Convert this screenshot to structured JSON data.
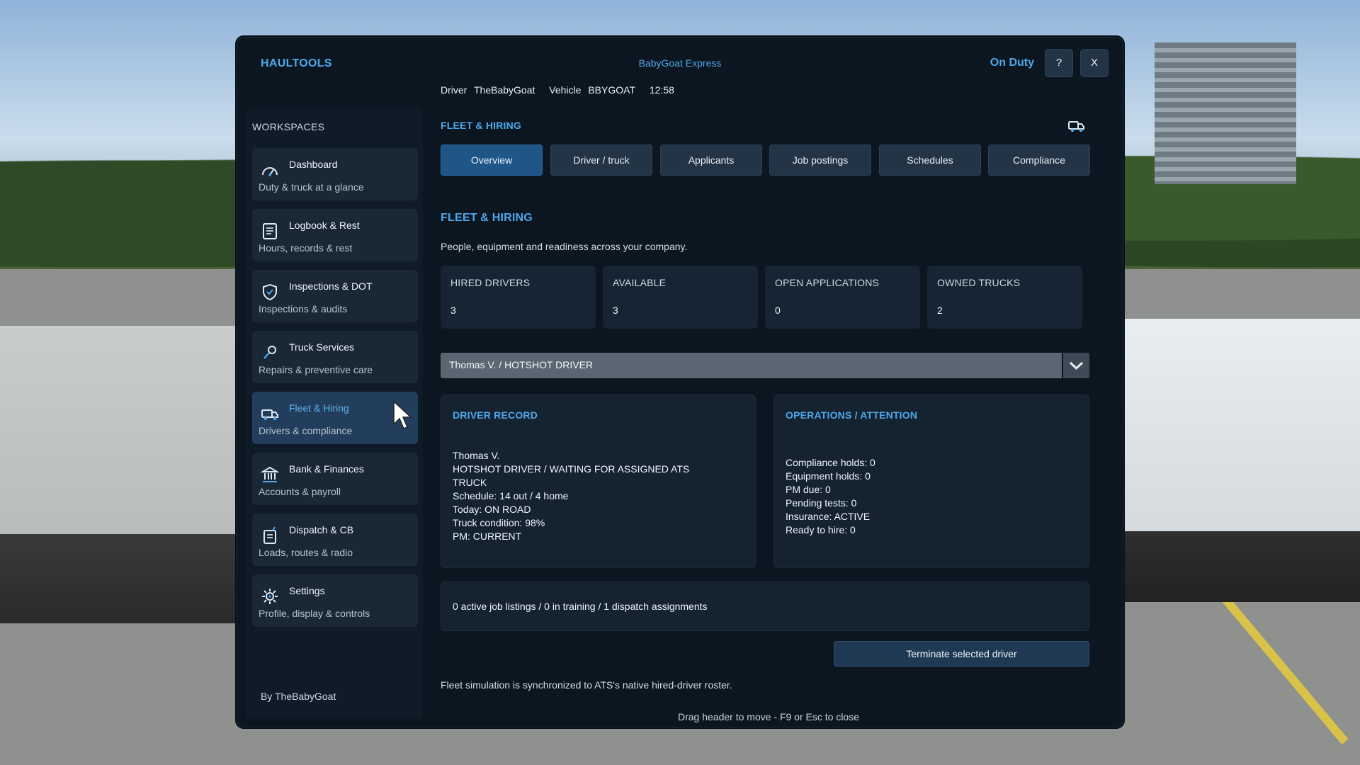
{
  "header": {
    "app_title": "HAULTOOLS",
    "company": "BabyGoat Express",
    "duty_status": "On Duty",
    "help_label": "?",
    "close_label": "X",
    "driver_label": "Driver",
    "driver_name": "TheBabyGoat",
    "vehicle_label": "Vehicle",
    "vehicle_id": "BBYGOAT",
    "time": "12:58"
  },
  "sidebar": {
    "title": "WORKSPACES",
    "items": [
      {
        "label": "Dashboard",
        "sub": "Duty & truck at a glance",
        "icon": "gauge-icon"
      },
      {
        "label": "Logbook & Rest",
        "sub": "Hours, records & rest",
        "icon": "logbook-icon"
      },
      {
        "label": "Inspections & DOT",
        "sub": "Inspections & audits",
        "icon": "shield-check-icon"
      },
      {
        "label": "Truck Services",
        "sub": "Repairs & preventive care",
        "icon": "wrench-icon"
      },
      {
        "label": "Fleet & Hiring",
        "sub": "Drivers & compliance",
        "icon": "truck-icon",
        "active": true
      },
      {
        "label": "Bank & Finances",
        "sub": "Accounts & payroll",
        "icon": "bank-icon"
      },
      {
        "label": "Dispatch & CB",
        "sub": "Loads, routes & radio",
        "icon": "dispatch-icon"
      },
      {
        "label": "Settings",
        "sub": "Profile, display & controls",
        "icon": "gear-icon"
      }
    ],
    "byline": "By TheBabyGoat"
  },
  "main": {
    "section_label": "FLEET & HIRING",
    "tabs": [
      {
        "label": "Overview",
        "active": true
      },
      {
        "label": "Driver / truck"
      },
      {
        "label": "Applicants"
      },
      {
        "label": "Job postings"
      },
      {
        "label": "Schedules"
      },
      {
        "label": "Compliance"
      }
    ],
    "page_title": "FLEET & HIRING",
    "page_desc": "People, equipment and readiness across your company.",
    "stats": [
      {
        "label": "HIRED DRIVERS",
        "value": "3"
      },
      {
        "label": "AVAILABLE",
        "value": "3"
      },
      {
        "label": "OPEN APPLICATIONS",
        "value": "0"
      },
      {
        "label": "OWNED TRUCKS",
        "value": "2"
      }
    ],
    "driver_select": "Thomas V. / HOTSHOT DRIVER",
    "driver_record": {
      "title": "DRIVER RECORD",
      "lines": [
        "Thomas V.",
        "HOTSHOT DRIVER / WAITING FOR ASSIGNED ATS",
        "TRUCK",
        "Schedule: 14 out / 4 home",
        "Today: ON ROAD",
        "Truck condition: 98%",
        "PM: CURRENT"
      ]
    },
    "operations": {
      "title": "OPERATIONS / ATTENTION",
      "lines": [
        "Compliance holds: 0",
        "Equipment holds: 0",
        "PM due: 0",
        "Pending tests: 0",
        "Insurance: ACTIVE",
        "Ready to hire: 0"
      ]
    },
    "summary": "0 active job listings / 0 in training / 1 dispatch assignments",
    "terminate_label": "Terminate selected driver",
    "footnote": "Fleet simulation is synchronized to ATS's native hired-driver roster.",
    "drag_hint": "Drag header to move - F9 or Esc to close"
  },
  "colors": {
    "accent": "#4ea8ec",
    "panel": "#0c1621",
    "active_tab": "#1f5687"
  }
}
